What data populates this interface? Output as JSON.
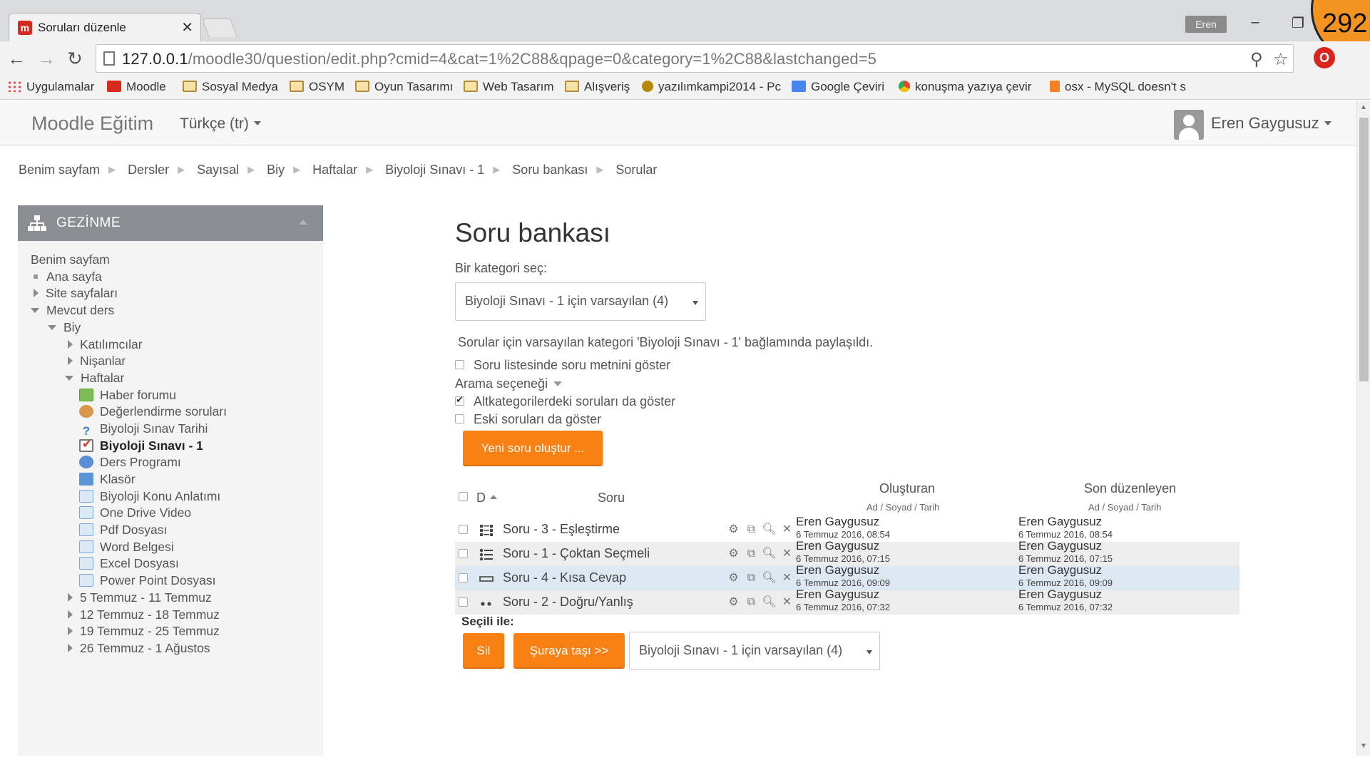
{
  "browser": {
    "tab_title": "Soruları düzenle",
    "tab_favicon": "m",
    "profile": "Eren",
    "counter": "292",
    "url_host": "127.0.0.1",
    "url_path": "/moodle30/question/edit.php?cmid=4&cat=1%2C88&qpage=0&category=1%2C88&lastchanged=5",
    "bookmarks": [
      {
        "label": "Uygulamalar",
        "icon": "apps-icon"
      },
      {
        "label": "Moodle",
        "icon": "moodle-icon"
      },
      {
        "label": "Sosyal Medya",
        "icon": "folder-icon"
      },
      {
        "label": "OSYM",
        "icon": "folder-icon"
      },
      {
        "label": "Oyun Tasarımı",
        "icon": "folder-icon"
      },
      {
        "label": "Web Tasarım",
        "icon": "folder-icon"
      },
      {
        "label": "Alışveriş",
        "icon": "folder-icon"
      },
      {
        "label": "yazılımkampi2014 - Pc",
        "icon": "paw-icon"
      },
      {
        "label": "Google Çeviri",
        "icon": "google-translate-icon"
      },
      {
        "label": "konuşma yazıya çevir",
        "icon": "chrome-icon"
      },
      {
        "label": "osx - MySQL doesn't s",
        "icon": "stackoverflow-icon"
      }
    ]
  },
  "navbar": {
    "brand": "Moodle Eğitim",
    "language": "Türkçe (tr)",
    "user": "Eren Gaygusuz"
  },
  "breadcrumb": [
    "Benim sayfam",
    "Dersler",
    "Sayısal",
    "Biy",
    "Haftalar",
    "Biyoloji Sınavı - 1",
    "Soru bankası",
    "Sorular"
  ],
  "nav_block": {
    "title": "GEZİNME",
    "items": [
      "Benim sayfam",
      "Ana sayfa",
      "Site sayfaları",
      "Mevcut ders",
      "Biy",
      "Katılımcılar",
      "Nişanlar",
      "Haftalar",
      "Haber forumu",
      "Değerlendirme soruları",
      "Biyoloji Sınav Tarihi",
      "Biyoloji Sınavı - 1",
      "Ders Programı",
      "Klasör",
      "Biyoloji Konu Anlatımı",
      "One Drive Video",
      "Pdf Dosyası",
      "Word Belgesi",
      "Excel Dosyası",
      "Power Point Dosyası",
      "5 Temmuz - 11 Temmuz",
      "12 Temmuz - 18 Temmuz",
      "19 Temmuz - 25 Temmuz",
      "26 Temmuz - 1 Ağustos"
    ]
  },
  "main": {
    "title": "Soru bankası",
    "category_label": "Bir kategori seç:",
    "category_value": "Biyoloji Sınavı - 1 için varsayılan (4)",
    "shared_info": "Sorular için varsayılan kategori 'Biyoloji Sınavı - 1' bağlamında paylaşıldı.",
    "show_text_label": "Soru listesinde soru metnini göster",
    "search_options": "Arama seçeneği",
    "subcat_label": "Altkategorilerdeki soruları da göster",
    "old_label": "Eski soruları da göster",
    "new_question": "Yeni soru oluştur ...",
    "col_type": "D",
    "col_question": "Soru",
    "col_created": "Oluşturan",
    "col_modified": "Son düzenleyen",
    "col_sub": "Ad / Soyad / Tarih",
    "with_selected": "Seçili ile:",
    "delete": "Sil",
    "move_to": "Şuraya taşı >>",
    "move_target": "Biyoloji Sınavı - 1 için varsayılan (4)"
  },
  "questions": [
    {
      "name": "Soru - 3 - Eşleştirme",
      "icon": "matching-icon",
      "created_by": "Eren Gaygusuz",
      "created": "6 Temmuz 2016, 08:54",
      "modified_by": "Eren Gaygusuz",
      "modified": "6 Temmuz 2016, 08:54"
    },
    {
      "name": "Soru - 1 - Çoktan Seçmeli",
      "icon": "multichoice-icon",
      "created_by": "Eren Gaygusuz",
      "created": "6 Temmuz 2016, 07:15",
      "modified_by": "Eren Gaygusuz",
      "modified": "6 Temmuz 2016, 07:15"
    },
    {
      "name": "Soru - 4 - Kısa Cevap",
      "icon": "shortanswer-icon",
      "created_by": "Eren Gaygusuz",
      "created": "6 Temmuz 2016, 09:09",
      "modified_by": "Eren Gaygusuz",
      "modified": "6 Temmuz 2016, 09:09"
    },
    {
      "name": "Soru - 2 - Doğru/Yanlış",
      "icon": "truefalse-icon",
      "created_by": "Eren Gaygusuz",
      "created": "6 Temmuz 2016, 07:32",
      "modified_by": "Eren Gaygusuz",
      "modified": "6 Temmuz 2016, 07:32"
    }
  ],
  "colors": {
    "accent": "#f98012",
    "block_header": "#8a8d92",
    "row_alt": "#ededed",
    "row_hover": "#dde8f2"
  }
}
